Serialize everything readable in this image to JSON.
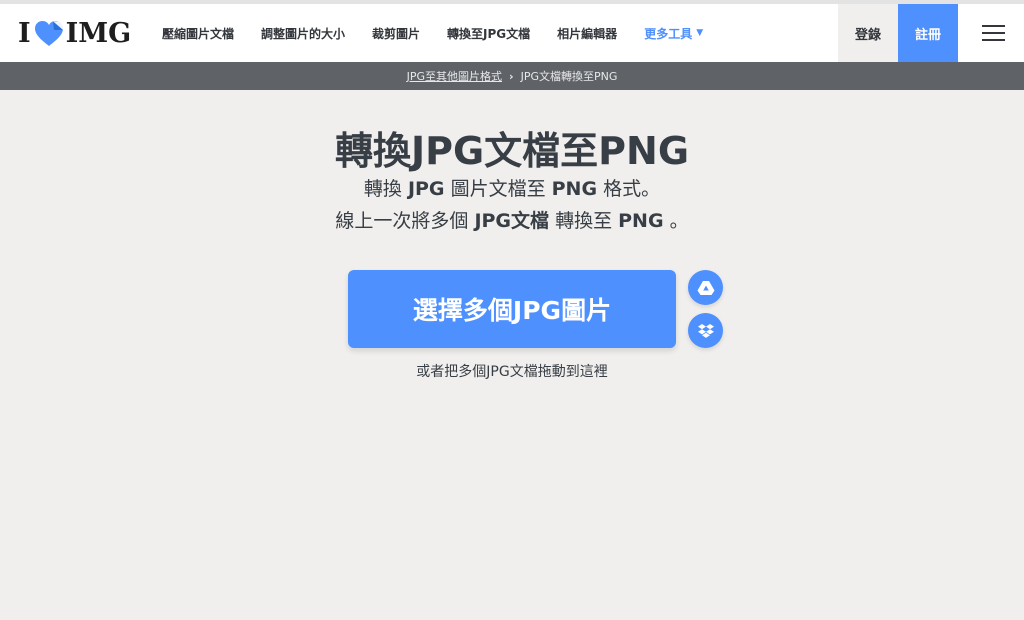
{
  "header": {
    "logo": {
      "left": "I",
      "right": "IMG"
    },
    "nav": [
      {
        "label": "壓縮圖片文檔"
      },
      {
        "label": "調整圖片的大小"
      },
      {
        "label": "裁剪圖片"
      },
      {
        "label": "轉換至JPG文檔"
      },
      {
        "label": "相片編輯器"
      }
    ],
    "more_tools": "更多工具",
    "login": "登錄",
    "register": "註冊"
  },
  "breadcrumb": {
    "parent": "JPG至其他圖片格式",
    "current": "JPG文檔轉換至PNG"
  },
  "main": {
    "title": "轉換JPG文檔至PNG",
    "subtitle1": {
      "a": "轉換 ",
      "b": "JPG",
      "c": " 圖片文檔至 ",
      "d": "PNG",
      "e": " 格式。"
    },
    "subtitle2": {
      "a": "線上一次將多個 ",
      "b": "JPG文檔",
      "c": " 轉換至 ",
      "d": "PNG",
      "e": " 。"
    },
    "select_button": "選擇多個JPG圖片",
    "drop_hint": "或者把多個JPG文檔拖動到這裡"
  },
  "colors": {
    "accent": "#4d90fe",
    "background": "#f0efed",
    "breadcrumb_bar": "#5f6368",
    "text": "#383e45"
  },
  "icons": {
    "logo_heart": "heart-icon",
    "more_caret": "caret-down-icon",
    "menu": "hamburger-icon",
    "cloud1": "google-drive-icon",
    "cloud2": "dropbox-icon"
  }
}
